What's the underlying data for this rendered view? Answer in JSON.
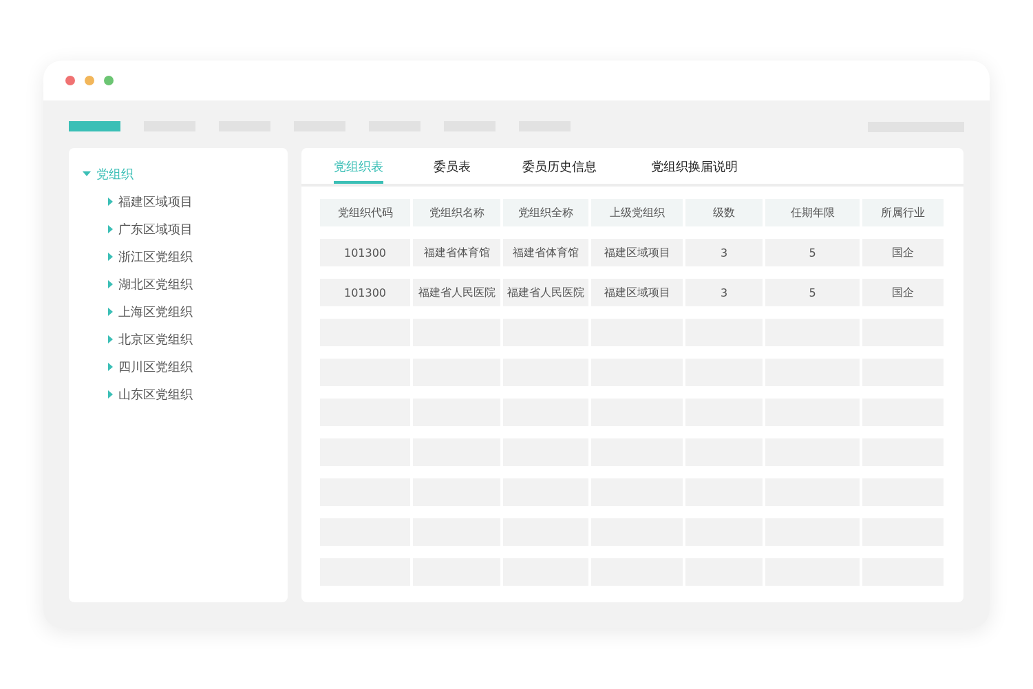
{
  "window": {
    "controls": [
      {
        "color": "#f07272"
      },
      {
        "color": "#f2b65a"
      },
      {
        "color": "#6cc573"
      }
    ]
  },
  "nav": {
    "items": [
      {
        "selected": true
      },
      {
        "selected": false
      },
      {
        "selected": false
      },
      {
        "selected": false
      },
      {
        "selected": false
      },
      {
        "selected": false
      },
      {
        "selected": false
      }
    ]
  },
  "sidebar": {
    "tree": [
      {
        "label": "党组织",
        "expanded": true,
        "children": [
          {
            "label": "福建区域项目",
            "expanded": false
          },
          {
            "label": "广东区域项目",
            "expanded": false
          },
          {
            "label": "浙江区党组织",
            "expanded": false
          },
          {
            "label": "湖北区党组织",
            "expanded": false
          },
          {
            "label": "上海区党组织",
            "expanded": false
          },
          {
            "label": "北京区党组织",
            "expanded": false
          },
          {
            "label": "四川区党组织",
            "expanded": false
          },
          {
            "label": "山东区党组织",
            "expanded": false
          }
        ]
      }
    ]
  },
  "tabs": [
    {
      "label": "党组织表",
      "selected": true
    },
    {
      "label": "委员表",
      "selected": false
    },
    {
      "label": "委员历史信息",
      "selected": false
    },
    {
      "label": "党组织换届说明",
      "selected": false
    }
  ],
  "table": {
    "columns": [
      "党组织代码",
      "党组织名称",
      "党组织全称",
      "上级党组织",
      "级数",
      "任期年限",
      "所属行业"
    ],
    "rows": [
      {
        "kind": "data",
        "cells": [
          "101300",
          "福建省体育馆",
          "福建省体育馆",
          "福建区域项目",
          "3",
          "5",
          "国企"
        ]
      },
      {
        "kind": "data",
        "cells": [
          "101300",
          "福建省人民医院",
          "福建省人民医院",
          "福建区域项目",
          "3",
          "5",
          "国企"
        ]
      },
      {
        "kind": "blank"
      },
      {
        "kind": "blank"
      },
      {
        "kind": "blank"
      },
      {
        "kind": "blank"
      },
      {
        "kind": "blank"
      },
      {
        "kind": "blank"
      },
      {
        "kind": "blank"
      }
    ]
  }
}
